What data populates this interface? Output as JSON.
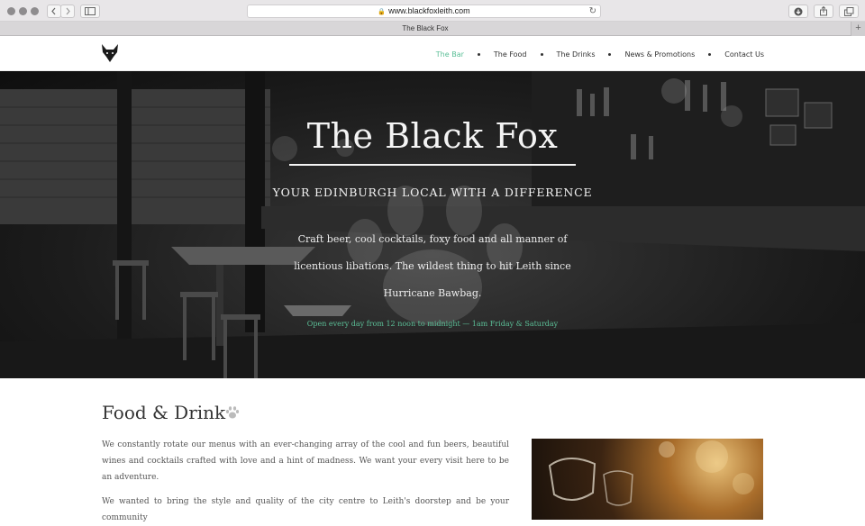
{
  "browser": {
    "url": "www.blackfoxleith.com",
    "tab_title": "The Black Fox",
    "back_icon": "chevron-left-icon",
    "forward_icon": "chevron-right-icon",
    "sidebar_icon": "sidebar-icon",
    "lock_icon": "lock-icon",
    "reload_icon": "reload-icon",
    "download_icon": "download-icon",
    "share_icon": "share-icon",
    "tabs_icon": "tabs-icon",
    "new_tab_label": "+"
  },
  "site": {
    "logo_icon": "fox-head-icon",
    "nav": [
      {
        "label": "The Bar",
        "active": true
      },
      {
        "label": "The Food",
        "active": false
      },
      {
        "label": "The Drinks",
        "active": false
      },
      {
        "label": "News & Promotions",
        "active": false
      },
      {
        "label": "Contact Us",
        "active": false
      }
    ],
    "accent_color": "#5bbf97"
  },
  "hero": {
    "title": "The Black Fox",
    "subtitle": "YOUR EDINBURGH LOCAL WITH A DIFFERENCE",
    "description": "Craft beer, cool cocktails, foxy food and all manner of licentious libations. The wildest thing to hit Leith since Hurricane Bawbag.",
    "hours": "Open every day from 12 noon to midnight — 1am Friday & Saturday"
  },
  "content": {
    "section_title": "Food & Drink",
    "section_icon": "paw-print-icon",
    "paragraph_1": "We constantly rotate our menus with an ever-changing array of the cool and fun beers, beautiful wines and cocktails crafted with love and a hint of madness. We want your every visit here to be an adventure.",
    "paragraph_2": "We wanted to bring the style and quality of the city centre to Leith's doorstep and be your community"
  }
}
